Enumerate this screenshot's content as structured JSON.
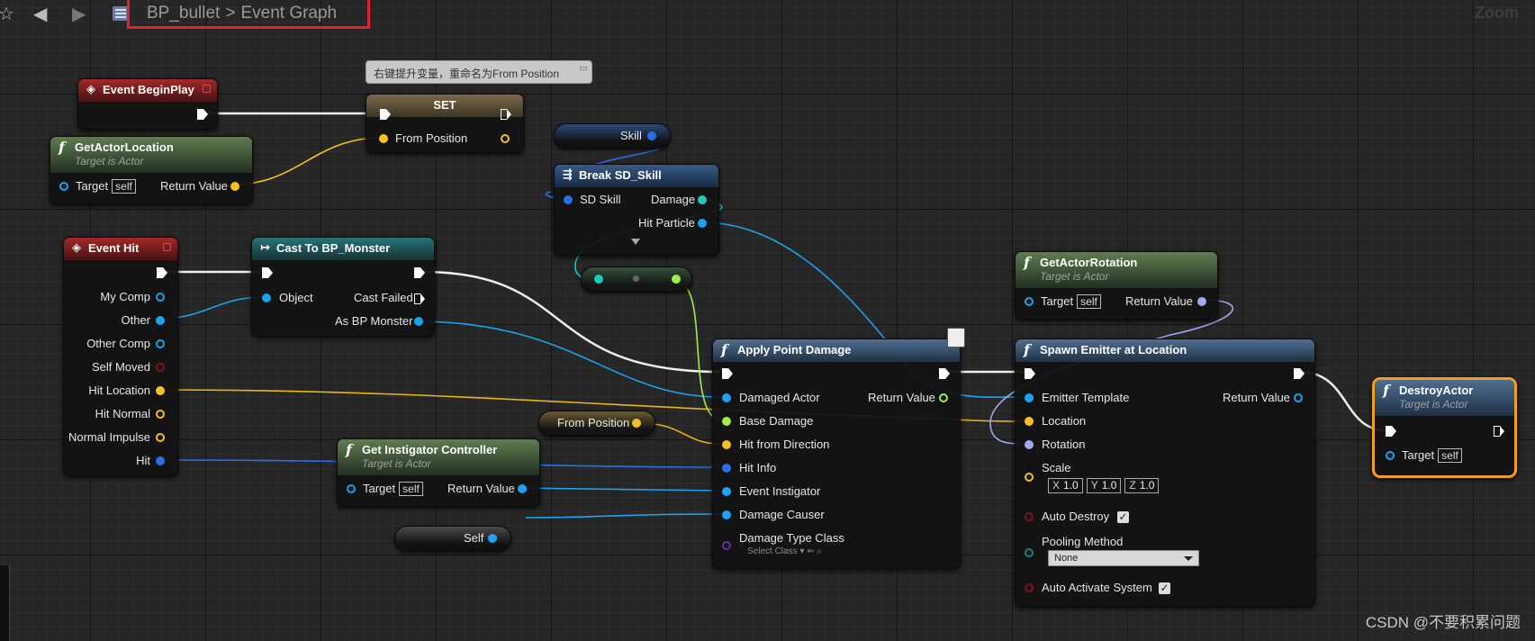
{
  "toolbar": {
    "favorite_icon": "star-icon",
    "back_icon": "arrow-left-icon",
    "forward_icon": "arrow-right-icon",
    "blueprint_icon": "blueprint-icon",
    "breadcrumb_root": "BP_bullet",
    "breadcrumb_separator": ">",
    "breadcrumb_current": "Event Graph",
    "zoom_label": "Zoom",
    "highlight_color": "#e0242a"
  },
  "comment": {
    "text": "右键提升变量，重命名为From Position",
    "icon": "comment-icon"
  },
  "nodes": {
    "event_begin_play": {
      "title": "Event BeginPlay"
    },
    "get_actor_location": {
      "title": "GetActorLocation",
      "subtitle": "Target is Actor",
      "target": "Target",
      "self": "self",
      "return": "Return Value"
    },
    "set": {
      "title": "SET",
      "from_position": "From Position"
    },
    "skill_var": {
      "label": "Skill"
    },
    "break_skill": {
      "title": "Break SD_Skill",
      "in": "SD Skill",
      "damage": "Damage",
      "hit_particle": "Hit Particle"
    },
    "event_hit": {
      "title": "Event Hit",
      "pins": [
        "My Comp",
        "Other",
        "Other Comp",
        "Self Moved",
        "Hit Location",
        "Hit Normal",
        "Normal Impulse",
        "Hit"
      ]
    },
    "cast": {
      "title": "Cast To BP_Monster",
      "object": "Object",
      "cast_failed": "Cast Failed",
      "as_monster": "As BP Monster"
    },
    "from_position_var": {
      "label": "From Position"
    },
    "get_instigator": {
      "title": "Get Instigator Controller",
      "subtitle": "Target is Actor",
      "target": "Target",
      "self": "self",
      "return": "Return Value"
    },
    "self_var": {
      "label": "Self"
    },
    "apply_damage": {
      "title": "Apply Point Damage",
      "return": "Return Value",
      "pins": [
        "Damaged Actor",
        "Base Damage",
        "Hit from Direction",
        "Hit Info",
        "Event Instigator",
        "Damage Causer",
        "Damage Type Class"
      ],
      "select_class": "Select Class"
    },
    "get_actor_rotation": {
      "title": "GetActorRotation",
      "subtitle": "Target is Actor",
      "target": "Target",
      "self": "self",
      "return": "Return Value"
    },
    "spawn_emitter": {
      "title": "Spawn Emitter at Location",
      "return": "Return Value",
      "emitter_template": "Emitter Template",
      "location": "Location",
      "rotation": "Rotation",
      "scale": "Scale",
      "scale_x_label": "X",
      "scale_x": "1.0",
      "scale_y_label": "Y",
      "scale_y": "1.0",
      "scale_z_label": "Z",
      "scale_z": "1.0",
      "auto_destroy": "Auto Destroy",
      "auto_destroy_checked": true,
      "pooling_method": "Pooling Method",
      "pooling_value": "None",
      "auto_activate": "Auto Activate System",
      "auto_activate_checked": true
    },
    "destroy_actor": {
      "title": "DestroyActor",
      "subtitle": "Target is Actor",
      "target": "Target",
      "self": "self"
    }
  },
  "colors": {
    "exec": "#ffffff",
    "object": "#1aa3f0",
    "vector": "#f5c020",
    "float": "#9df04a",
    "rotator": "#9fa8f0",
    "struct": "#2a6ee8",
    "bool": "#8a1010",
    "teal": "#20c8c0",
    "class": "#6a2ab8",
    "selection": "#f0a020"
  },
  "watermark": "CSDN @不要积累问题"
}
